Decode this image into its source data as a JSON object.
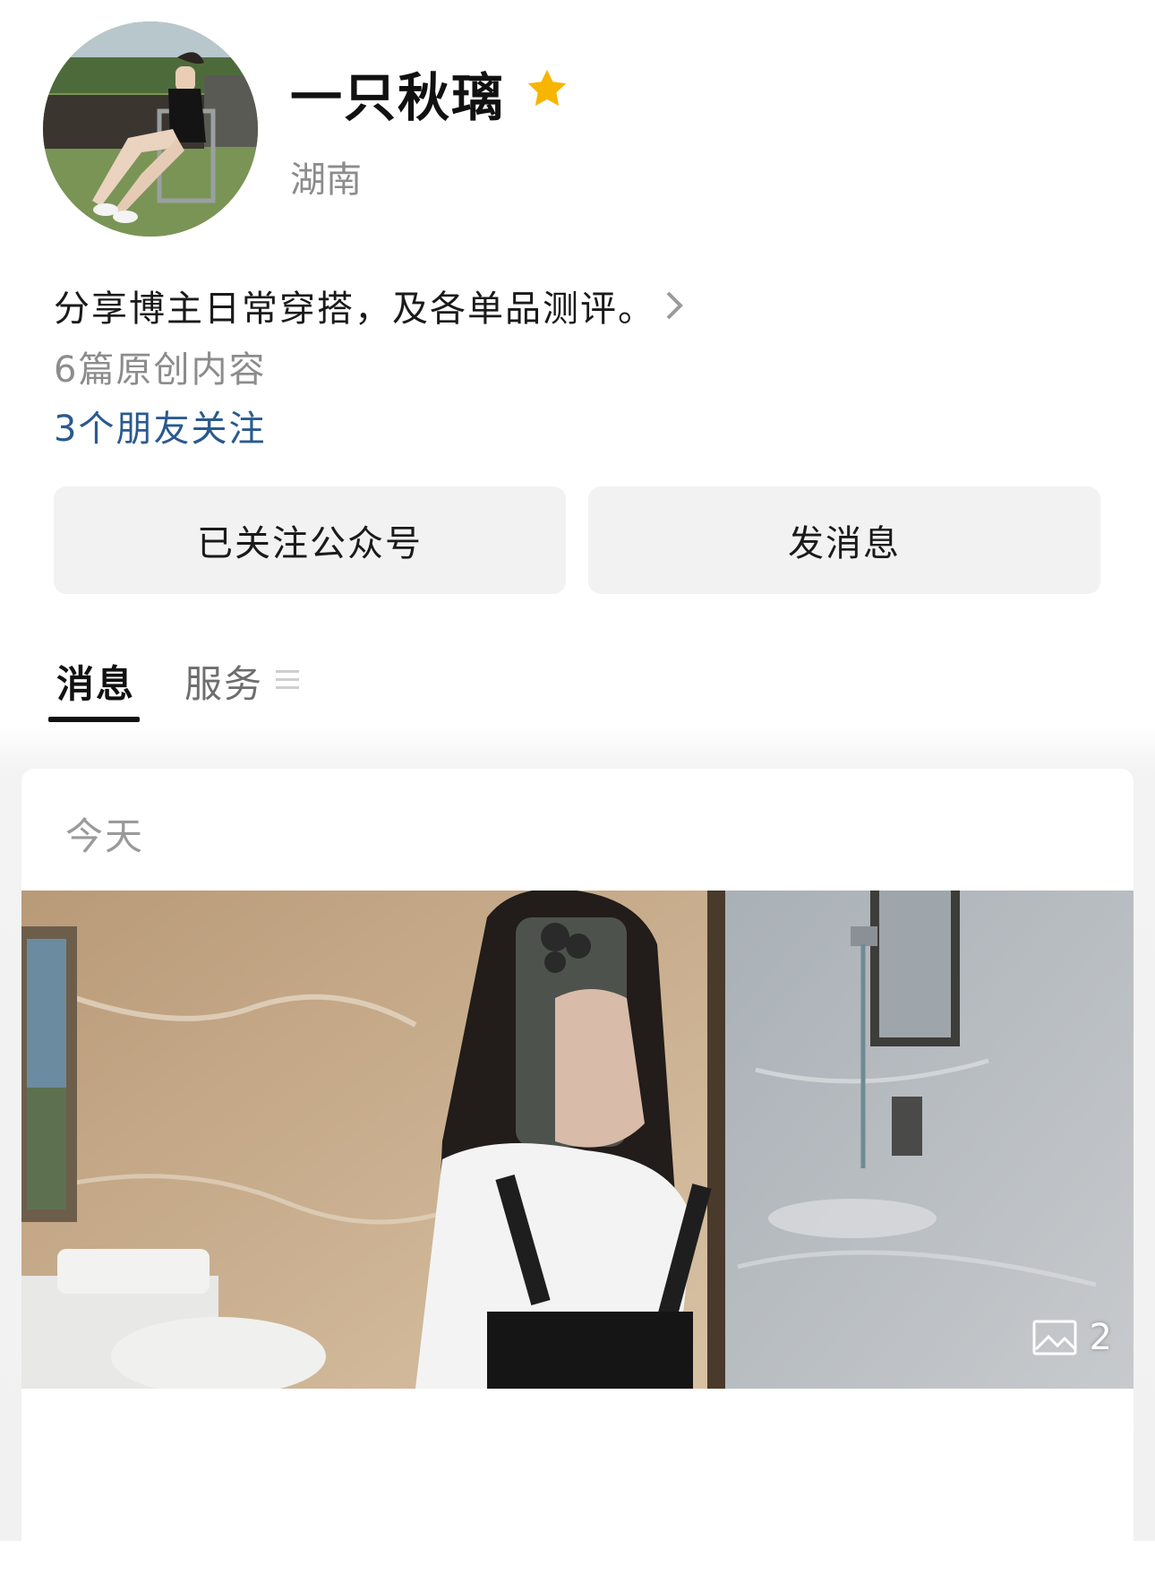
{
  "profile": {
    "name": "一只秋璃",
    "region": "湖南",
    "bio": "分享博主日常穿搭，及各单品测评。",
    "article_count": "6篇原创内容",
    "friends_following": "3个朋友关注",
    "star_color": "#f7b500",
    "link_color": "#2a5a8e"
  },
  "actions": {
    "follow_label": "已关注公众号",
    "message_label": "发消息"
  },
  "tabs": [
    {
      "label": "消息",
      "active": true
    },
    {
      "label": "服务",
      "active": false
    }
  ],
  "feed": {
    "date_label": "今天",
    "image_count": "2"
  },
  "icons": {
    "star": "star-icon",
    "chevron": "chevron-right-icon",
    "menu": "menu-icon",
    "gallery": "gallery-icon"
  }
}
